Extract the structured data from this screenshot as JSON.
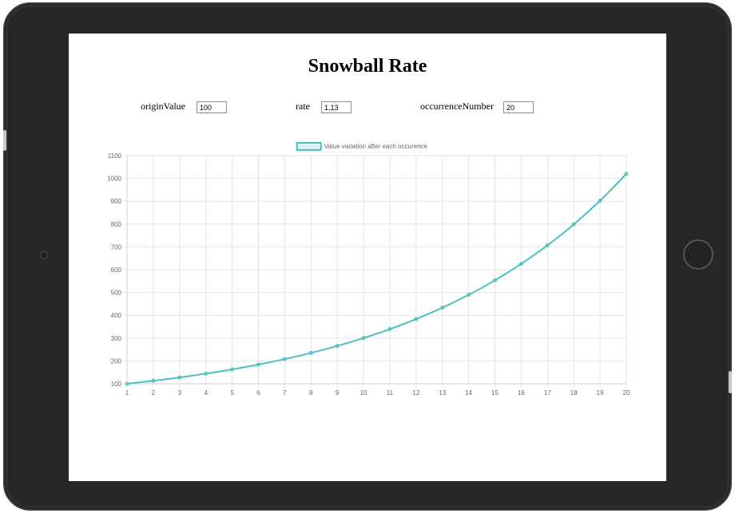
{
  "page": {
    "title": "Snowball Rate"
  },
  "inputs": {
    "origin_label": "originValue",
    "origin_value": "100",
    "rate_label": "rate",
    "rate_value": "1,13",
    "occurrence_label": "occurrenceNumber",
    "occurrence_value": "20"
  },
  "chart_data": {
    "type": "line",
    "x": [
      1,
      2,
      3,
      4,
      5,
      6,
      7,
      8,
      9,
      10,
      11,
      12,
      13,
      14,
      15,
      16,
      17,
      18,
      19,
      20
    ],
    "series": [
      {
        "name": "Value variation after each occurence",
        "values": [
          100,
          113,
          127.69,
          144.29,
          163.05,
          184.24,
          208.19,
          235.26,
          265.84,
          300.4,
          339.46,
          383.59,
          433.45,
          489.8,
          553.47,
          625.42,
          706.73,
          798.6,
          902.42,
          1019.74
        ],
        "color": "#4bc0c0"
      }
    ],
    "ylim": [
      100,
      1100
    ],
    "yticks": [
      100,
      200,
      300,
      400,
      500,
      600,
      700,
      800,
      900,
      1000,
      1100
    ],
    "grid": true,
    "legend": "top-center"
  }
}
